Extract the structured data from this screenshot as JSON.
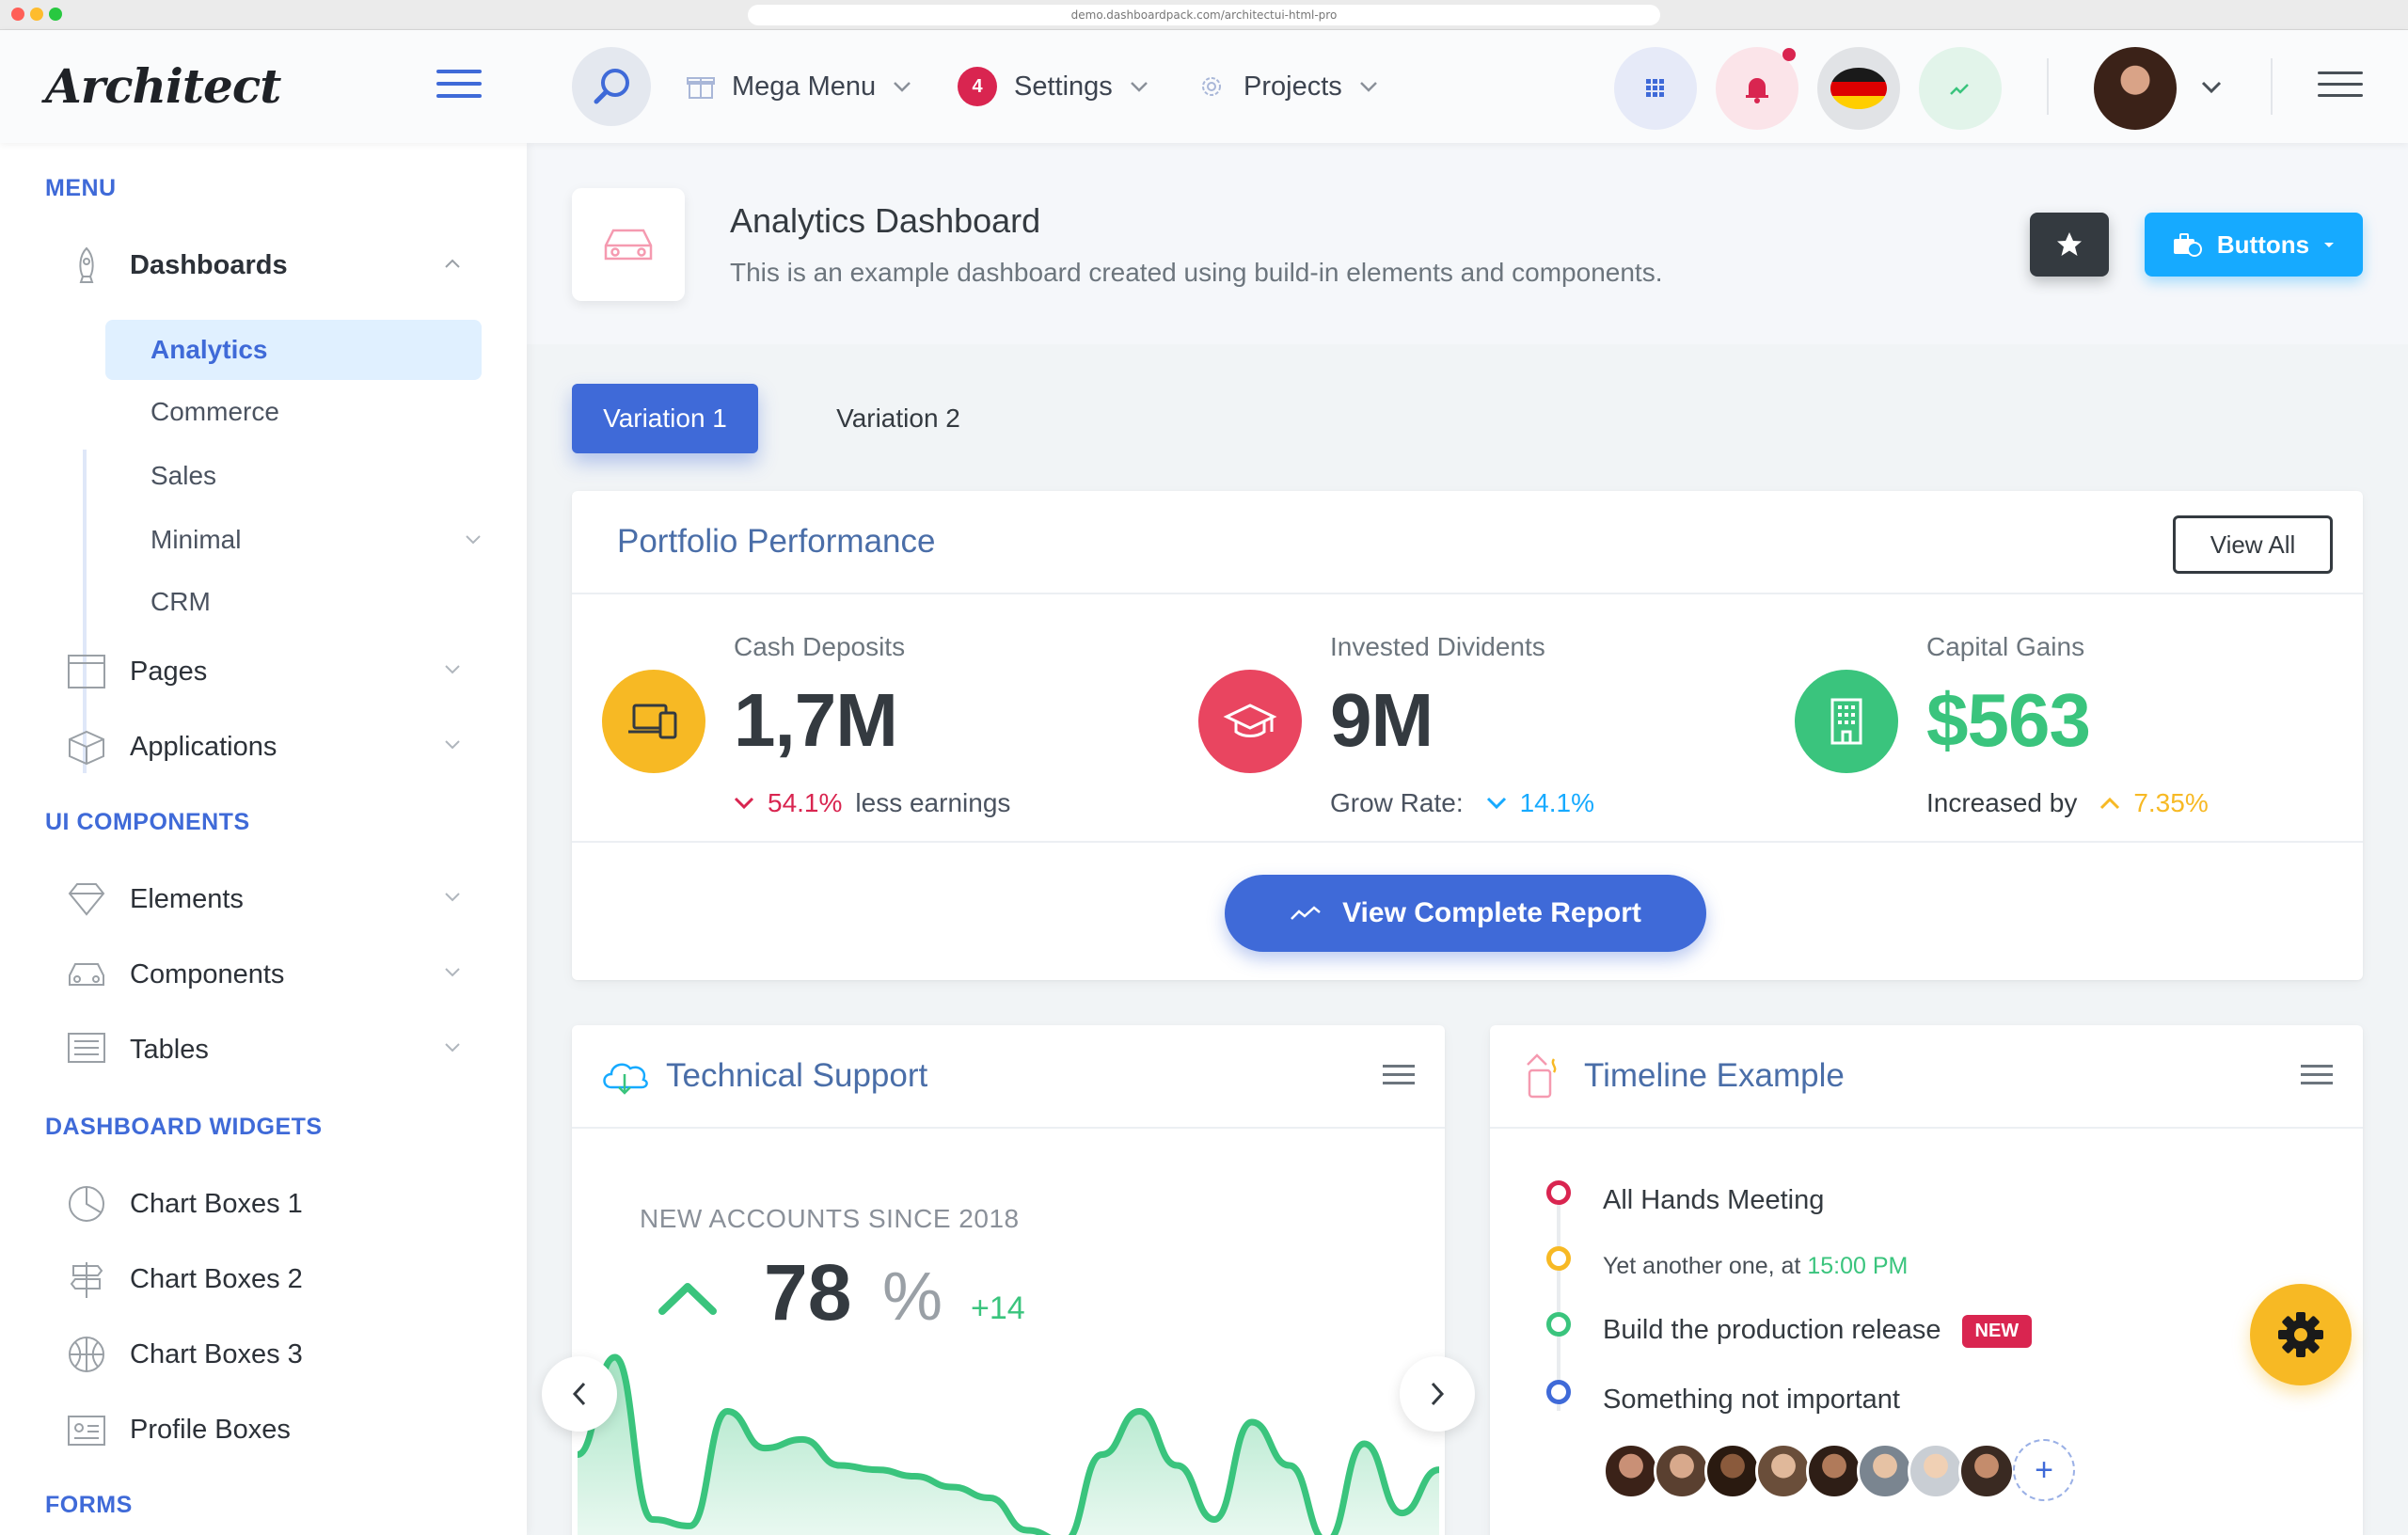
{
  "browser": {
    "url": "demo.dashboardpack.com/architectui-html-pro"
  },
  "header": {
    "logo": "Architect",
    "nav": [
      {
        "label": "Mega Menu"
      },
      {
        "label": "Settings",
        "badge": "4"
      },
      {
        "label": "Projects"
      }
    ]
  },
  "sidebar": {
    "sections": {
      "menu": "MENU",
      "ui_components": "UI COMPONENTS",
      "dashboard_widgets": "DASHBOARD WIDGETS",
      "forms": "FORMS"
    },
    "dashboards": {
      "label": "Dashboards",
      "children": [
        "Analytics",
        "Commerce",
        "Sales",
        "Minimal",
        "CRM"
      ]
    },
    "menu_items": [
      "Pages",
      "Applications"
    ],
    "ui_items": [
      "Elements",
      "Components",
      "Tables"
    ],
    "widget_items": [
      "Chart Boxes 1",
      "Chart Boxes 2",
      "Chart Boxes 3",
      "Profile Boxes"
    ]
  },
  "page": {
    "title": "Analytics Dashboard",
    "subtitle": "This is an example dashboard created using build-in elements and components.",
    "buttons_label": "Buttons"
  },
  "tabs": [
    "Variation 1",
    "Variation 2"
  ],
  "portfolio": {
    "title": "Portfolio Performance",
    "view_all": "View All",
    "stats": [
      {
        "label": "Cash Deposits",
        "value": "1,7M",
        "foot_value": "54.1%",
        "foot_text": "less earnings"
      },
      {
        "label": "Invested Dividents",
        "value": "9M",
        "foot_text": "Grow Rate:",
        "foot_value": "14.1%"
      },
      {
        "label": "Capital Gains",
        "value": "$563",
        "foot_text": "Increased by",
        "foot_value": "7.35%"
      }
    ],
    "report_button": "View Complete Report"
  },
  "support": {
    "title": "Technical Support",
    "accounts_label": "NEW ACCOUNTS SINCE 2018",
    "number": "78",
    "percent": "%",
    "delta": "+14",
    "sparkline": [
      0.55,
      0.1,
      0.85,
      0.88,
      0.35,
      0.52,
      0.48,
      0.6,
      0.62,
      0.65,
      0.7,
      0.75,
      0.9,
      0.95,
      0.55,
      0.35,
      0.6,
      0.85,
      0.4,
      0.6,
      0.95,
      0.5,
      0.82,
      0.62
    ]
  },
  "timeline": {
    "title": "Timeline Example",
    "items": [
      {
        "text": "All Hands Meeting",
        "color": "#d92550"
      },
      {
        "text": "Yet another one, at ",
        "time": "15:00 PM",
        "color": "#f7b924"
      },
      {
        "text": "Build the production release",
        "badge": "NEW",
        "color": "#3ac47d"
      },
      {
        "text": "Something not important",
        "color": "#3f6ad8"
      }
    ],
    "add_label": "+"
  },
  "colors": {
    "primary": "#3f6ad8",
    "info": "#16aaff",
    "warning": "#f7b924",
    "danger": "#d92550",
    "success": "#3ac47d",
    "dark": "#343a40"
  }
}
